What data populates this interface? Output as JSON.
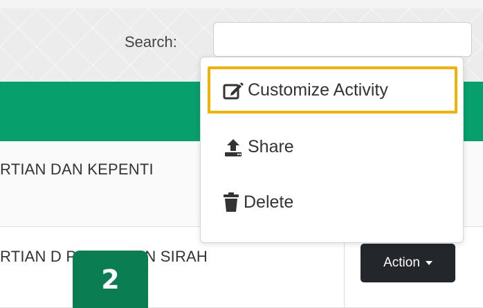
{
  "search": {
    "label": "Search:",
    "value": "",
    "placeholder": ""
  },
  "table": {
    "rows": [
      {
        "title": "RTIAN DAN KEPENTI"
      },
      {
        "title": "RTIAN D          PENTINGAN SIRAH",
        "action_label": "Action"
      }
    ]
  },
  "dropdown": {
    "items": [
      {
        "label": "Customize Activity",
        "icon": "edit-icon",
        "highlighted": true
      },
      {
        "label": "Share",
        "icon": "upload-icon"
      },
      {
        "label": "Delete",
        "icon": "trash-icon"
      }
    ]
  },
  "badge": {
    "text": "2"
  },
  "colors": {
    "header_green": "#079f6c",
    "badge_green": "#0b7d52",
    "highlight": "#f0b400",
    "action_button": "#23262b"
  }
}
